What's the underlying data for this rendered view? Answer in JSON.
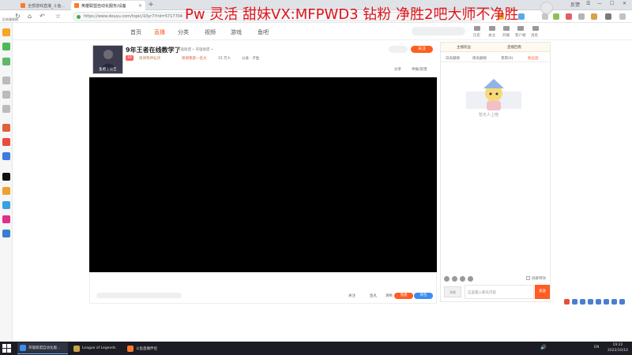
{
  "browser": {
    "tabs": [
      {
        "label": "全部游戏直播_斗鱼..."
      },
      {
        "label": "英雄联盟自动化服务/设备"
      }
    ],
    "new_tab": "+",
    "win_right": [
      "反馈",
      "☰",
      "—",
      "☐",
      "✕"
    ],
    "nav": {
      "back": "‹",
      "forward": "›",
      "refresh": "↻",
      "home": "⌂",
      "undo": "↶",
      "star": "☆"
    },
    "url": "https://www.douyu.com/topic/10yr7?rid=5717704",
    "bookmark_label": "旧衣服收纳"
  },
  "overlay_text": "Pw 灵活 甜妹VX:MFPWD3 钻粉 净胜2吧大师不净胜",
  "site_nav": {
    "items": [
      "首页",
      "直播",
      "分类",
      "视频",
      "游戏",
      "鱼吧"
    ],
    "active_index": 1,
    "right_links": [
      "历史",
      "关注",
      "开播",
      "客户端",
      "消息"
    ]
  },
  "room": {
    "avatar_label": "鱼吧 | 公告",
    "title": "9年王者在线教学了",
    "subtitle": "英雄联盟 • 英雄联盟 •",
    "level_badge": "10",
    "badge_text": "谢谢我神仙顶",
    "rank_label": "谢谢我第一名大",
    "fans": "15 万人",
    "announcement": "公会 · 子鱼",
    "follow_label": "关注",
    "share_label": "分享",
    "report_label": "举报/反馈"
  },
  "below_player": {
    "follow_small": "关注",
    "follow_count": "鱼丸",
    "hd_label": "清晰",
    "orange_pill": "充值",
    "blue_pill": "背包"
  },
  "right_panel": {
    "top_tabs": [
      "主播权益",
      "直播回看"
    ],
    "tabs": [
      "日贡献榜",
      "周贡献榜",
      "贵宾(0)",
      "粉丝团"
    ],
    "active_tab": 3,
    "mascot_caption": "暂无人上榜",
    "chat_placeholder": "这里输入聊天内容",
    "send_label": "发送",
    "input_icon_label": "弹幕",
    "checkbox_label": "屏蔽特效"
  },
  "taskbar": {
    "items": [
      {
        "label": "英雄联盟自动化服..."
      },
      {
        "label": "League of Legends"
      },
      {
        "label": "斗鱼直播伴侣"
      }
    ],
    "sys_icons": [
      "🔊",
      "EN"
    ],
    "time": "19:22",
    "date": "2022/10/10"
  }
}
